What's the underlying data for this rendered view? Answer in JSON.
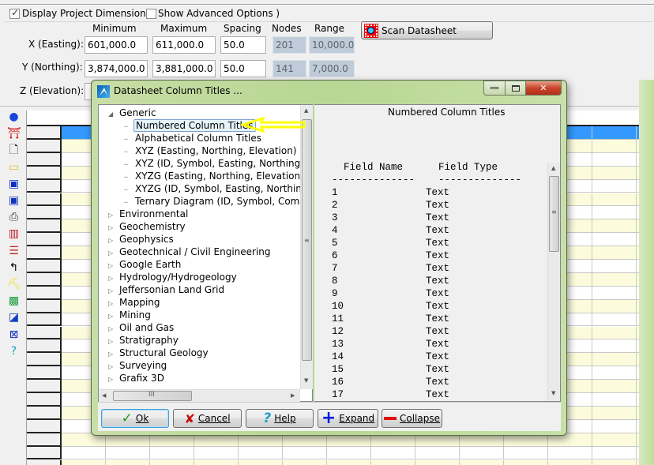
{
  "project": {
    "display_dims_label": "Display Project Dimensions (",
    "display_dims_checked": true,
    "advanced_label": "Show Advanced Options )",
    "advanced_checked": false,
    "headers": {
      "min": "Minimum",
      "max": "Maximum",
      "spacing": "Spacing",
      "nodes": "Nodes",
      "range": "Range"
    },
    "x": {
      "label": "X (Easting):",
      "min": "601,000.0",
      "max": "611,000.0",
      "spacing": "50.0",
      "nodes": "201",
      "range": "10,000.0"
    },
    "y": {
      "label": "Y (Northing):",
      "min": "3,874,000.0",
      "max": "3,881,000.0",
      "spacing": "50.0",
      "nodes": "141",
      "range": "7,000.0"
    },
    "z": {
      "label": "Z (Elevation):"
    },
    "scan_label": "Scan Datasheet"
  },
  "toolbar": [
    "database-icon",
    "exit-icon",
    "new-file-icon",
    "open-folder-icon",
    "save-icon",
    "save-as-icon",
    "print-icon",
    "column-width-icon",
    "row-height-icon",
    "undo-icon",
    "pick-icon",
    "map-icon",
    "geo-icon",
    "grid-icon",
    "help-icon"
  ],
  "dialog": {
    "title": "Datasheet Column Titles ...",
    "tree": {
      "root": "Generic",
      "children": [
        "Numbered Column Titles",
        "Alphabetical Column Titles",
        "XYZ (Easting, Northing, Elevation)",
        "XYZ (ID, Symbol, Easting, Northing, El",
        "XYZG (Easting, Northing, Elevation, Gr",
        "XYZG (ID, Symbol, Easting, Northing, ",
        "Ternary Diagram (ID, Symbol, Compon"
      ],
      "selected": "Numbered Column Titles",
      "categories": [
        "Environmental",
        "Geochemistry",
        "Geophysics",
        "Geotechnical / Civil Engineering",
        "Google Earth",
        "Hydrology/Hydrogeology",
        "Jeffersonian Land Grid",
        "Mapping",
        "Mining",
        "Oil and Gas",
        "Stratigraphy",
        "Structural Geology",
        "Surveying",
        "Grafix 3D"
      ]
    },
    "preview": {
      "title": "Numbered Column Titles",
      "col_name": "Field Name",
      "col_type": "Field Type",
      "rule": "--------------",
      "rows": [
        [
          "1",
          "Text"
        ],
        [
          "2",
          "Text"
        ],
        [
          "3",
          "Text"
        ],
        [
          "4",
          "Text"
        ],
        [
          "5",
          "Text"
        ],
        [
          "6",
          "Text"
        ],
        [
          "7",
          "Text"
        ],
        [
          "8",
          "Text"
        ],
        [
          "9",
          "Text"
        ],
        [
          "10",
          "Text"
        ],
        [
          "11",
          "Text"
        ],
        [
          "12",
          "Text"
        ],
        [
          "13",
          "Text"
        ],
        [
          "14",
          "Text"
        ],
        [
          "15",
          "Text"
        ],
        [
          "16",
          "Text"
        ],
        [
          "17",
          "Text"
        ]
      ]
    },
    "buttons": {
      "ok": "Ok",
      "cancel": "Cancel",
      "help": "Help",
      "expand": "Expand",
      "collapse": "Collapse"
    },
    "colors": {
      "annotation_arrow": "#ffff00",
      "selection": "#3399ff",
      "row_alt": "#fcfcdc"
    }
  }
}
